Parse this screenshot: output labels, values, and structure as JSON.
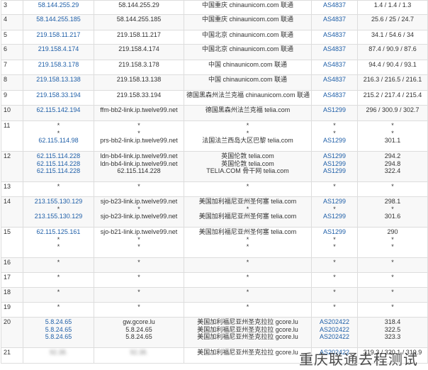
{
  "rows": [
    {
      "hop": "3",
      "ip_link": [
        "58.144.255.29"
      ],
      "host": [
        "58.144.255.29"
      ],
      "loc": [
        "中国重庆 chinaunicom.com 联通"
      ],
      "asn": [
        "AS4837"
      ],
      "rtt": [
        "1.4 / 1.4 / 1.3"
      ],
      "h": 20
    },
    {
      "hop": "4",
      "ip_link": [
        "58.144.255.185"
      ],
      "host": [
        "58.144.255.185"
      ],
      "loc": [
        "中国重庆 chinaunicom.com 联通"
      ],
      "asn": [
        "AS4837"
      ],
      "rtt": [
        "25.6 / 25 / 24.7"
      ],
      "h": 22
    },
    {
      "hop": "5",
      "ip_link": [
        "219.158.11.217"
      ],
      "host": [
        "219.158.11.217"
      ],
      "loc": [
        "中国北京 chinaunicom.com 联通"
      ],
      "asn": [
        "AS4837"
      ],
      "rtt": [
        "34.1 / 54.6 / 34"
      ],
      "h": 20
    },
    {
      "hop": "6",
      "ip_link": [
        "219.158.4.174"
      ],
      "host": [
        "219.158.4.174"
      ],
      "loc": [
        "中国北京 chinaunicom.com 联通"
      ],
      "asn": [
        "AS4837"
      ],
      "rtt": [
        "87.4 / 90.9 / 87.6"
      ],
      "h": 22
    },
    {
      "hop": "7",
      "ip_link": [
        "219.158.3.178"
      ],
      "host": [
        "219.158.3.178"
      ],
      "loc": [
        "中国 chinaunicom.com 联通"
      ],
      "asn": [
        "AS4837"
      ],
      "rtt": [
        "94.4 / 90.4 / 93.1"
      ],
      "h": 21
    },
    {
      "hop": "8",
      "ip_link": [
        "219.158.13.138"
      ],
      "host": [
        "219.158.13.138"
      ],
      "loc": [
        "中国 chinaunicom.com 联通"
      ],
      "asn": [
        "AS4837"
      ],
      "rtt": [
        "216.3 / 216.5 / 216.1"
      ],
      "h": 22
    },
    {
      "hop": "9",
      "ip_link": [
        "219.158.33.194"
      ],
      "host": [
        "219.158.33.194"
      ],
      "loc": [
        "德国黑森州法兰克福 chinaunicom.com 联通"
      ],
      "asn": [
        "AS4837"
      ],
      "rtt": [
        "215.2 / 217.4 / 215.4"
      ],
      "h": 21
    },
    {
      "hop": "10",
      "ip_link": [
        "62.115.142.194"
      ],
      "host": [
        "ffm-bb2-link.ip.twelve99.net"
      ],
      "loc": [
        "德国黑森州法兰克福 telia.com"
      ],
      "asn": [
        "AS1299"
      ],
      "rtt": [
        "296 / 300.9 / 302.7"
      ],
      "h": 22
    },
    {
      "hop": "11",
      "ip_link": [
        "",
        "",
        "62.115.114.98"
      ],
      "host": [
        "*",
        "*",
        "prs-bb2-link.ip.twelve99.net"
      ],
      "loc": [
        "*",
        "*",
        "法国法兰西岛大区巴黎 telia.com"
      ],
      "asn": [
        "*",
        "*",
        "AS1299"
      ],
      "rtt": [
        "*",
        "*",
        "301.1"
      ],
      "ip_stars": [
        "*",
        "*",
        ""
      ],
      "h": 43
    },
    {
      "hop": "12",
      "ip_link": [
        "62.115.114.228",
        "62.115.114.228",
        "62.115.114.228"
      ],
      "host": [
        "ldn-bb4-link.ip.twelve99.net",
        "ldn-bb4-link.ip.twelve99.net",
        "62.115.114.228"
      ],
      "loc": [
        "英国伦敦 telia.com",
        "英国伦敦 telia.com",
        "TELIA.COM 骨干网 telia.com"
      ],
      "asn": [
        "AS1299",
        "AS1299",
        "AS1299"
      ],
      "rtt": [
        "294.2",
        "294.8",
        "322.4"
      ],
      "h": 43
    },
    {
      "hop": "13",
      "ip_link": [
        "*"
      ],
      "host": [
        "*"
      ],
      "loc": [
        "*"
      ],
      "asn": [
        "*"
      ],
      "rtt": [
        "*"
      ],
      "h": 21,
      "star_row": true
    },
    {
      "hop": "14",
      "ip_link": [
        "213.155.130.129",
        "",
        "213.155.130.129"
      ],
      "host": [
        "sjo-b23-link.ip.twelve99.net",
        "*",
        "sjo-b23-link.ip.twelve99.net"
      ],
      "loc": [
        "美国加利福尼亚州圣何塞 telia.com",
        "*",
        "美国加利福尼亚州圣何塞 telia.com"
      ],
      "asn": [
        "AS1299",
        "*",
        "AS1299"
      ],
      "rtt": [
        "298.1",
        "*",
        "301.6"
      ],
      "ip_stars": [
        "",
        "*",
        ""
      ],
      "h": 43
    },
    {
      "hop": "15",
      "ip_link": [
        "62.115.125.161",
        "",
        ""
      ],
      "host": [
        "sjo-b21-link.ip.twelve99.net",
        "*",
        "*"
      ],
      "loc": [
        "美国加利福尼亚州圣何塞 telia.com",
        "*",
        "*"
      ],
      "asn": [
        "AS1299",
        "*",
        "*"
      ],
      "rtt": [
        "290",
        "*",
        "*"
      ],
      "ip_stars": [
        "",
        "*",
        "*"
      ],
      "h": 43
    },
    {
      "hop": "16",
      "ip_link": [
        "*"
      ],
      "host": [
        "*"
      ],
      "loc": [
        "*"
      ],
      "asn": [
        "*"
      ],
      "rtt": [
        "*"
      ],
      "h": 21,
      "star_row": true
    },
    {
      "hop": "17",
      "ip_link": [
        "*"
      ],
      "host": [
        "*"
      ],
      "loc": [
        "*"
      ],
      "asn": [
        "*"
      ],
      "rtt": [
        "*"
      ],
      "h": 21,
      "star_row": true
    },
    {
      "hop": "18",
      "ip_link": [
        "*"
      ],
      "host": [
        "*"
      ],
      "loc": [
        "*"
      ],
      "asn": [
        "*"
      ],
      "rtt": [
        "*"
      ],
      "h": 21,
      "star_row": true
    },
    {
      "hop": "19",
      "ip_link": [
        "*"
      ],
      "host": [
        "*"
      ],
      "loc": [
        "*"
      ],
      "asn": [
        "*"
      ],
      "rtt": [
        "*"
      ],
      "h": 21,
      "star_row": true
    },
    {
      "hop": "20",
      "ip_link": [
        "5.8.24.65",
        "5.8.24.65",
        "5.8.24.65"
      ],
      "host": [
        "gw.gcore.lu",
        "5.8.24.65",
        "5.8.24.65"
      ],
      "loc": [
        "美国加利福尼亚州圣克拉拉 gcore.lu",
        "美国加利福尼亚州圣克拉拉 gcore.lu",
        "美国加利福尼亚州圣克拉拉 gcore.lu"
      ],
      "asn": [
        "AS202422",
        "AS202422",
        "AS202422"
      ],
      "rtt": [
        "318.4",
        "322.5",
        "323.3"
      ],
      "h": 43
    },
    {
      "hop": "21",
      "ip_link": [
        "92.38."
      ],
      "host": [
        "92.38."
      ],
      "loc": [
        "美国加利福尼亚州圣克拉拉 gcore.lu"
      ],
      "asn": [
        "AS202422"
      ],
      "rtt": [
        "319.3 / 320.1 / 319.9"
      ],
      "h": 22
    }
  ],
  "watermark": "重庆联通去程测试"
}
